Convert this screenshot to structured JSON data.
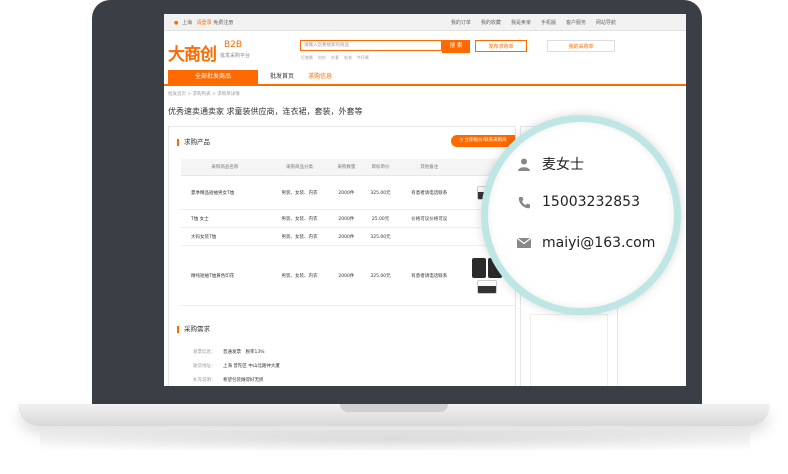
{
  "topbar": {
    "location": "上海",
    "login": "请登录",
    "register": "免费注册",
    "links": [
      "我的订单",
      "我的收藏",
      "我是卖家",
      "手机版",
      "客户服务",
      "网站导航"
    ]
  },
  "header": {
    "logo": "大商创",
    "logo_b2b": "B2B",
    "logo_sub": "批发采购平台",
    "search_placeholder": "请输入您要搜索的商品",
    "search_btn": "搜 索",
    "post_btn": "发布求购单",
    "cart_btn": "我的采购单",
    "hot_words": [
      "打底裤",
      "衬衫",
      "外套",
      "毛衣",
      "牛仔裤"
    ]
  },
  "nav": {
    "all": "全部批发商品",
    "items": [
      "批发首页",
      "求购信息"
    ]
  },
  "breadcrumb": "批发首页 > 求购列表 > 求购单详情",
  "page_title": "优秀速卖通卖家 求童装供应商，连衣裙，套装，外套等",
  "card": {
    "section1": "求购产品",
    "quote_btn": "立即报价/联系采购商",
    "headers": [
      "采购商品名称",
      "采购商品分类",
      "采购数量",
      "目标单价",
      "其他备注"
    ],
    "rows": [
      {
        "name": "夏季精品短袖男女T恤",
        "cat": "男装、女装、内衣",
        "qty": "2000件",
        "price": "325.00元",
        "note": "有意者请电话联系"
      },
      {
        "name": "T恤 女士",
        "cat": "男装、女装、内衣",
        "qty": "2000件",
        "price": "25.00元",
        "note": "价格可议价格可议"
      },
      {
        "name": "大码女装T恤",
        "cat": "男装、女装、内衣",
        "qty": "2000件",
        "price": "325.00元",
        "note": ""
      },
      {
        "name": "精纯短袖T恤黄色印花",
        "cat": "男装、女装、内衣",
        "qty": "2000件",
        "price": "325.00元",
        "note": "有意者请电话联系"
      }
    ],
    "section2": "采购需求",
    "info": [
      {
        "k": "发票信息：",
        "v": "普通发票　税率13%"
      },
      {
        "k": "收货地址：",
        "v": "上海 普陀区 中山北路仲大厦"
      },
      {
        "k": "补充说明：",
        "v": "希望包装做得好无损"
      }
    ]
  },
  "contact": {
    "name": "麦女士",
    "phone": "15003232853",
    "email": "maiyi@163.com"
  }
}
